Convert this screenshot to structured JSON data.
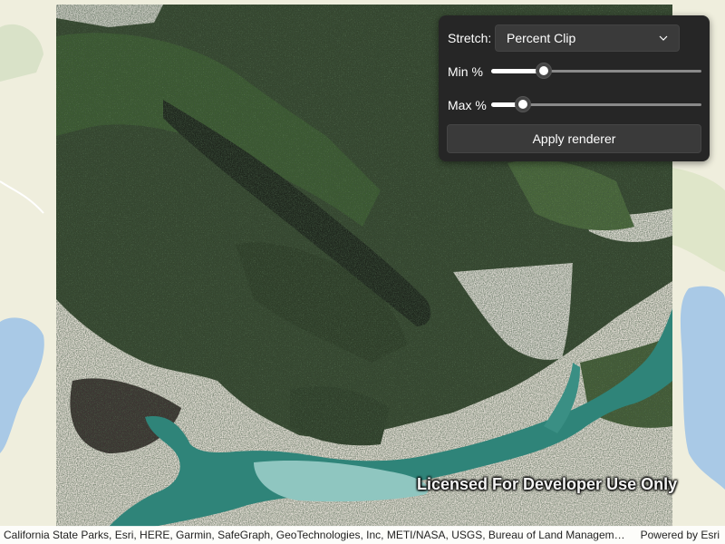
{
  "renderer_panel": {
    "stretch_label": "Stretch:",
    "stretch_value": "Percent Clip",
    "min_label": "Min %",
    "min_value_fraction": 0.25,
    "max_label": "Max %",
    "max_value_fraction": 0.15,
    "apply_label": "Apply renderer"
  },
  "map": {
    "watermark": "Licensed For Developer Use Only",
    "attribution": "California State Parks, Esri, HERE, Garmin, SafeGraph, GeoTechnologies, Inc, METI/NASA, USGS, Bureau of Land Management, EPA,...",
    "powered_by": "Powered by Esri"
  },
  "colors": {
    "panel_bg": "#262626",
    "basemap_land": "#efeedd",
    "basemap_water": "#a9c9e6",
    "raster_forest": "#2f3f2a",
    "raster_water": "#2f8479"
  }
}
